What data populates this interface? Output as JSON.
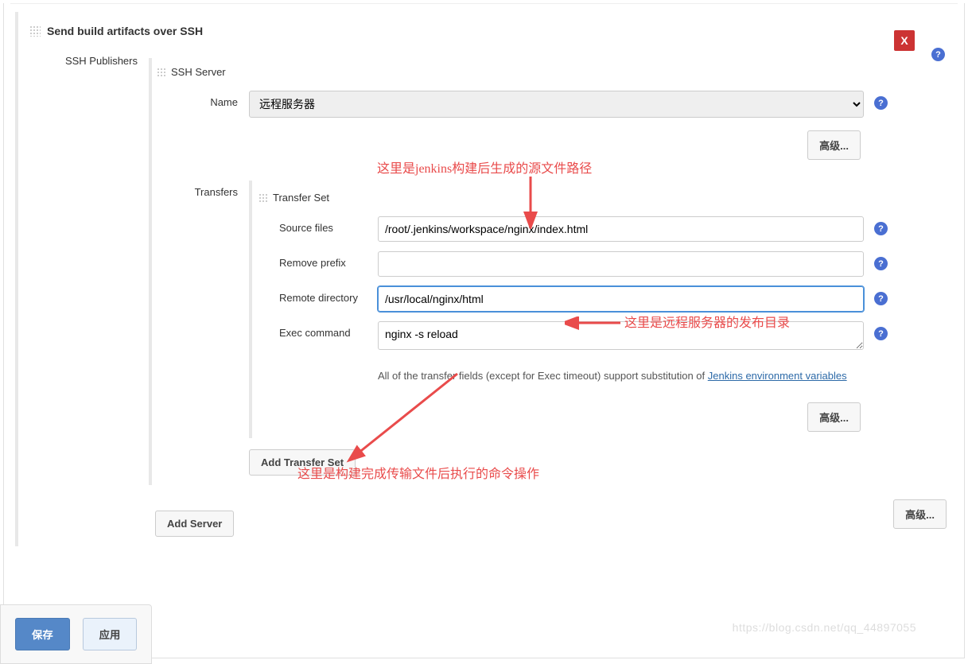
{
  "section": {
    "title": "Send build artifacts over SSH"
  },
  "publishers": {
    "label": "SSH Publishers"
  },
  "ssh_server": {
    "section_label": "SSH Server",
    "name_label": "Name",
    "name_value": "远程服务器",
    "advanced": "高级..."
  },
  "transfers": {
    "label": "Transfers",
    "set_label": "Transfer Set",
    "source_label": "Source files",
    "source_value": "/root/.jenkins/workspace/nginx/index.html",
    "remove_prefix_label": "Remove prefix",
    "remove_prefix_value": "",
    "remote_dir_label": "Remote directory",
    "remote_dir_value": "/usr/local/nginx/html",
    "exec_label": "Exec command",
    "exec_value": "nginx -s reload",
    "help_text_prefix": "All of the transfer fields (except for Exec timeout) support substitution of ",
    "help_text_link": "Jenkins environment variables",
    "advanced": "高级...",
    "add_set": "Add Transfer Set"
  },
  "add_server": "Add Server",
  "bottom_advanced": "高级...",
  "footer": {
    "save": "保存",
    "apply": "应用"
  },
  "annotations": {
    "source_note": "这里是jenkins构建后生成的源文件路径",
    "remote_note": "这里是远程服务器的发布目录",
    "exec_note": "这里是构建完成传输文件后执行的命令操作"
  },
  "close_x": "X",
  "watermark": "https://blog.csdn.net/qq_44897055"
}
